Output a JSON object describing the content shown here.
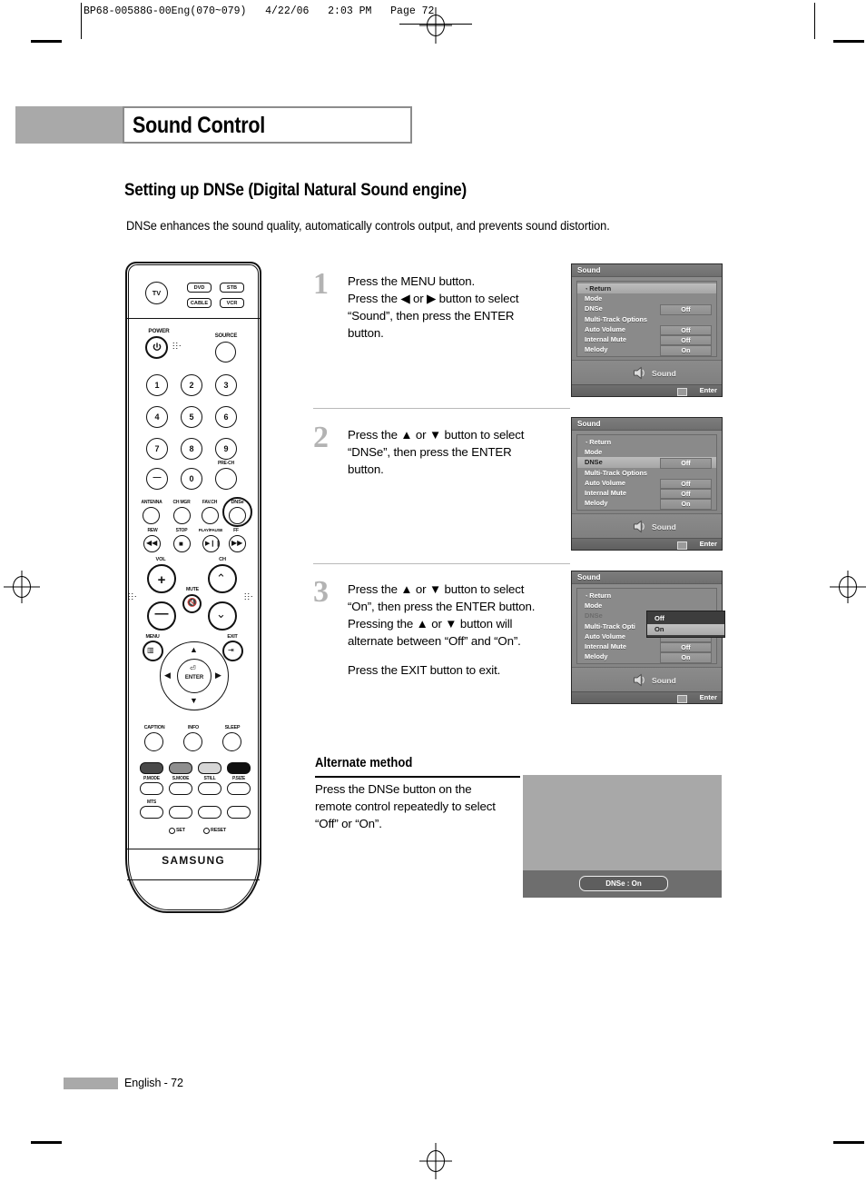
{
  "slug": {
    "text": "BP68-00588G-00Eng(070~079)   4/22/06   2:03 PM   Page 72"
  },
  "header": {
    "chapter_title": "Sound Control",
    "section_title": "Setting up DNSe (Digital Natural Sound engine)",
    "lead": "DNSe enhances the sound quality, automatically controls output, and prevents sound distortion."
  },
  "steps": [
    {
      "number": "1",
      "lines": [
        "Press the MENU button.\nPress the ◀ or ▶ button to select\n“Sound”, then press the ENTER\nbutton."
      ]
    },
    {
      "number": "2",
      "lines": [
        "Press the ▲ or ▼ button to select\n“DNSe”, then press the ENTER\nbutton."
      ]
    },
    {
      "number": "3",
      "lines": [
        "Press the ▲ or ▼ button to select\n“On”, then press the ENTER button.\nPressing the ▲ or ▼ button will\nalternate between “Off” and “On”.",
        "Press the EXIT button to exit."
      ]
    }
  ],
  "osd": {
    "title": "Sound",
    "footer_label": "Sound",
    "enter_label": "Enter",
    "menus": [
      {
        "id": "menu-step-1",
        "rows": [
          {
            "label": "Return",
            "value": "",
            "state": "selected",
            "icon": "return-icon"
          },
          {
            "label": "Mode",
            "value": "",
            "state": "normal"
          },
          {
            "label": "DNSe",
            "value": "Off",
            "state": "normal"
          },
          {
            "label": "Multi-Track Options",
            "value": "",
            "state": "normal"
          },
          {
            "label": "Auto Volume",
            "value": "Off",
            "state": "normal"
          },
          {
            "label": "Internal Mute",
            "value": "Off",
            "state": "normal"
          },
          {
            "label": "Melody",
            "value": "On",
            "state": "normal"
          }
        ],
        "popup": null
      },
      {
        "id": "menu-step-2",
        "rows": [
          {
            "label": "Return",
            "value": "",
            "state": "normal",
            "icon": "return-icon"
          },
          {
            "label": "Mode",
            "value": "",
            "state": "normal"
          },
          {
            "label": "DNSe",
            "value": "Off",
            "state": "selected"
          },
          {
            "label": "Multi-Track Options",
            "value": "",
            "state": "normal"
          },
          {
            "label": "Auto Volume",
            "value": "Off",
            "state": "normal"
          },
          {
            "label": "Internal Mute",
            "value": "Off",
            "state": "normal"
          },
          {
            "label": "Melody",
            "value": "On",
            "state": "normal"
          }
        ],
        "popup": null
      },
      {
        "id": "menu-step-3",
        "rows": [
          {
            "label": "Return",
            "value": "",
            "state": "normal",
            "icon": "return-icon"
          },
          {
            "label": "Mode",
            "value": "",
            "state": "normal"
          },
          {
            "label": "DNSe",
            "value": "",
            "state": "dim"
          },
          {
            "label": "Multi-Track Opti",
            "value": "",
            "state": "normal"
          },
          {
            "label": "Auto Volume",
            "value": "",
            "state": "normal"
          },
          {
            "label": "Internal Mute",
            "value": "Off",
            "state": "normal"
          },
          {
            "label": "Melody",
            "value": "On",
            "state": "normal"
          }
        ],
        "popup": {
          "options": [
            {
              "label": "Off",
              "selected": false
            },
            {
              "label": "On",
              "selected": true
            }
          ]
        }
      }
    ]
  },
  "alternate": {
    "heading": "Alternate method",
    "body": "Press the DNSe button on the\nremote control repeatedly to select\n“Off” or “On”.",
    "tv_banner_text": "DNSe : On"
  },
  "remote": {
    "brand": "SAMSUNG",
    "device_buttons": [
      "DVD",
      "STB",
      "CABLE",
      "VCR"
    ],
    "tv_button": "TV",
    "power_label": "POWER",
    "source_label": "SOURCE",
    "keypad": [
      "1",
      "2",
      "3",
      "4",
      "5",
      "6",
      "7",
      "8",
      "9",
      "—",
      "0"
    ],
    "pre_ch_label": "PRE-CH",
    "function_row": [
      "ANTENNA",
      "CH MGR",
      "FAV.CH",
      "DNSe"
    ],
    "transport_row": [
      "REW",
      "STOP",
      "PLAY/PAUSE",
      "FF"
    ],
    "vol_label": "VOL",
    "ch_label": "CH",
    "mute_label": "MUTE",
    "menu_label": "MENU",
    "exit_label": "EXIT",
    "enter_label": "ENTER",
    "bottom_row": [
      "CAPTION",
      "INFO",
      "SLEEP"
    ],
    "mode_row": [
      "P.MODE",
      "S.MODE",
      "STILL",
      "P.SIZE"
    ],
    "mts_label": "MTS",
    "set_label": "SET",
    "reset_label": "RESET",
    "color_buttons": [
      "#4a4a4a",
      "#8e8e8e",
      "#d6d6d6",
      "#111111"
    ]
  },
  "footer": {
    "page_label": "English - 72"
  }
}
